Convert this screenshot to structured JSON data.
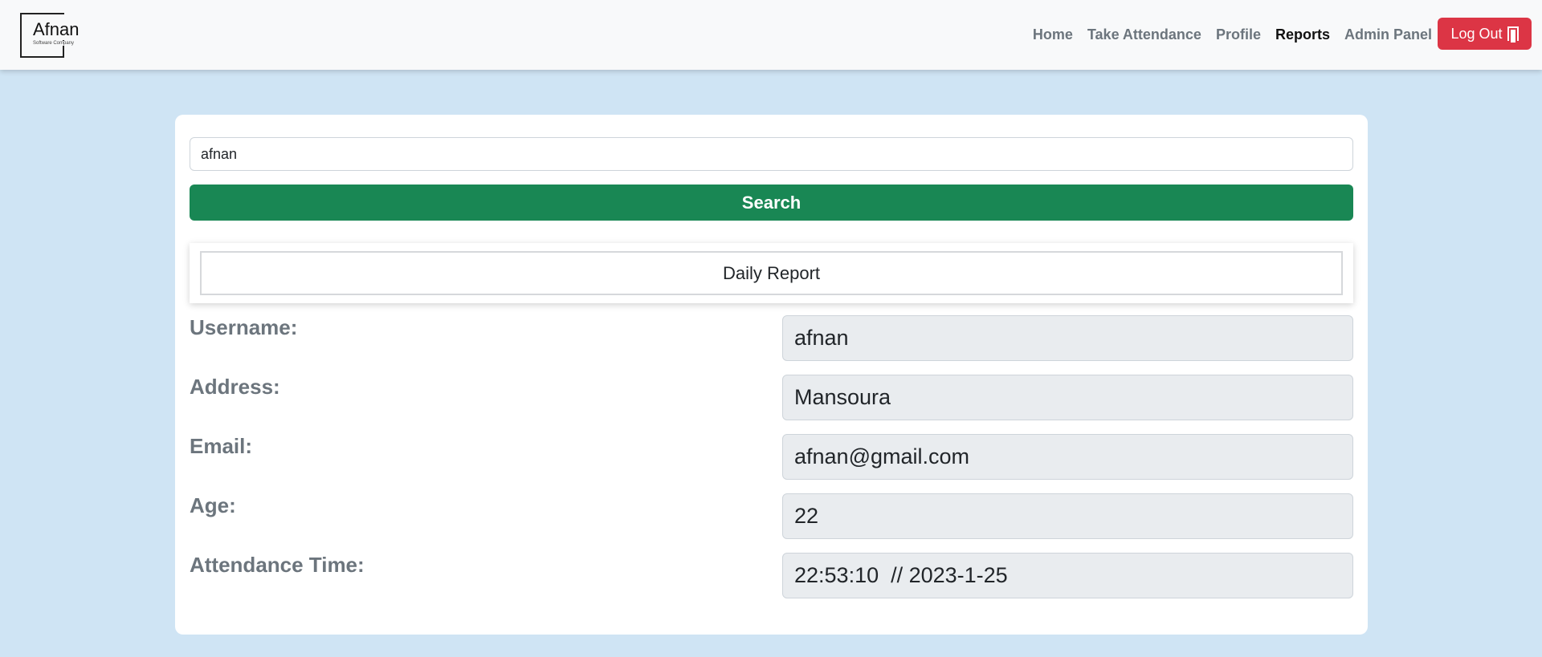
{
  "brand": {
    "name": "Afnan",
    "tagline": "Software Company"
  },
  "nav": {
    "links": [
      {
        "label": "Home",
        "active": false
      },
      {
        "label": "Take Attendance",
        "active": false
      },
      {
        "label": "Profile",
        "active": false
      },
      {
        "label": "Reports",
        "active": true
      },
      {
        "label": "Admin Panel",
        "active": false
      }
    ],
    "logout_label": "Log Out",
    "logout_icon": "door-icon"
  },
  "search": {
    "value": "afnan",
    "button_label": "Search"
  },
  "report": {
    "title": "Daily Report",
    "fields": [
      {
        "label": "Username:",
        "value": "afnan"
      },
      {
        "label": "Address:",
        "value": "Mansoura"
      },
      {
        "label": "Email:",
        "value": "afnan@gmail.com"
      },
      {
        "label": "Age:",
        "value": "22"
      },
      {
        "label": "Attendance Time:",
        "value": "22:53:10  // 2023-1-25"
      }
    ]
  },
  "colors": {
    "page_background": "#cfe4f4",
    "search_button": "#198754",
    "logout_button": "#dc3545"
  }
}
